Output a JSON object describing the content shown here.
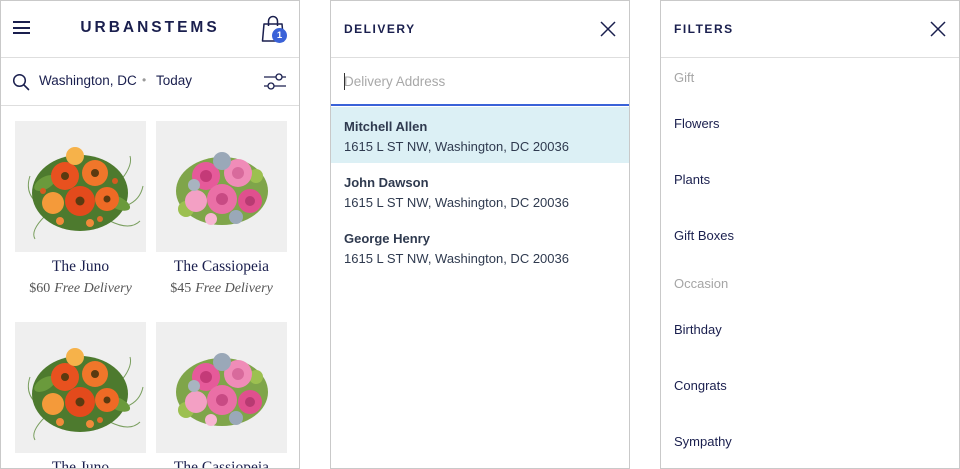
{
  "shop": {
    "brand": "URBANSTEMS",
    "cart_count": "1",
    "location": {
      "city": "Washington, DC",
      "separator": "•",
      "day": "Today"
    },
    "products": [
      {
        "name": "The Juno",
        "price": "$60",
        "delivery": "Free Delivery",
        "image": "orange-bouquet"
      },
      {
        "name": "The Cassiopeia",
        "price": "$45",
        "delivery": "Free Delivery",
        "image": "pink-bouquet"
      },
      {
        "name": "The Juno",
        "image": "orange-bouquet"
      },
      {
        "name": "The Cassiopeia",
        "image": "pink-bouquet"
      }
    ]
  },
  "delivery": {
    "title": "DELIVERY",
    "placeholder": "Delivery Address",
    "addresses": [
      {
        "name": "Mitchell Allen",
        "address": "1615 L ST NW, Washington, DC 20036",
        "highlighted": true
      },
      {
        "name": "John Dawson",
        "address": "1615 L ST NW, Washington, DC 20036"
      },
      {
        "name": "George Henry",
        "address": "1615 L ST NW, Washington, DC 20036"
      }
    ]
  },
  "filters": {
    "title": "FILTERS",
    "groups": [
      {
        "label": "Gift",
        "options": [
          "Flowers",
          "Plants",
          "Gift Boxes"
        ]
      },
      {
        "label": "Occasion",
        "options": [
          "Birthday",
          "Congrats",
          "Sympathy"
        ]
      }
    ]
  },
  "colors": {
    "navy": "#1a1f4e",
    "accent": "#3a62d8",
    "highlight": "#dcf0f5"
  },
  "icons": [
    "hamburger-icon",
    "shopping-bag-icon",
    "search-icon",
    "filter-sliders-icon",
    "close-icon"
  ]
}
